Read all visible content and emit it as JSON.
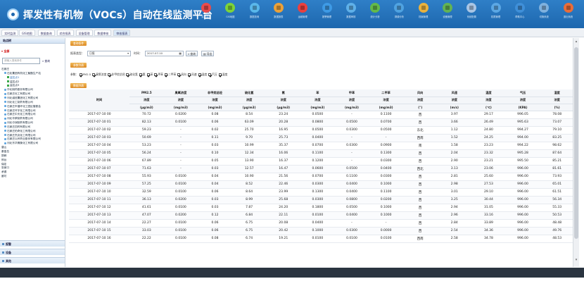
{
  "header": {
    "title": "挥发性有机物（VOCs）自动在线监测平台",
    "nav": [
      {
        "label": "实时监测",
        "color": "#e94b4b"
      },
      {
        "label": "GIS地图",
        "color": "#7dd33a"
      },
      {
        "label": "数据查询",
        "color": "#59b7ea"
      },
      {
        "label": "数据报表",
        "color": "#eaa13a"
      },
      {
        "label": "运维管理",
        "color": "#e84040"
      },
      {
        "label": "报警管理",
        "color": "#3e9ae5"
      },
      {
        "label": "数据审核",
        "color": "#5fb0e8"
      },
      {
        "label": "统计分析",
        "color": "#63b94a"
      },
      {
        "label": "溯源分析",
        "color": "#4fa2e0"
      },
      {
        "label": "档案管理",
        "color": "#e9b23e"
      },
      {
        "label": "设备管理",
        "color": "#62b354"
      },
      {
        "label": "系统配置",
        "color": "#a9c5e4"
      },
      {
        "label": "权限管理",
        "color": "#5ba7e4"
      },
      {
        "label": "帮助中心",
        "color": "#3f8fd8"
      },
      {
        "label": "切换系统",
        "color": "#7fb1de"
      },
      {
        "label": "退出系统",
        "color": "#e96d3a"
      }
    ]
  },
  "tabs": [
    "实时监测",
    "GIS地图",
    "数据查询",
    "综合报表",
    "设备管理",
    "数据审核",
    "审核报表"
  ],
  "sidebar": {
    "header": "站点树",
    "scope": "全部",
    "search_placeholder": "请输入搜索条件",
    "search_button": "查询",
    "tree": [
      {
        "label": "石家庄",
        "level": 0,
        "type": "folder"
      },
      {
        "label": "石化集团有机化工聚酯生产站",
        "level": 1,
        "type": "site"
      },
      {
        "label": "监控点1",
        "level": 2,
        "type": "point",
        "selected": true
      },
      {
        "label": "监控点2",
        "level": 2,
        "type": "point"
      },
      {
        "label": "监控点3",
        "level": 2,
        "type": "point"
      },
      {
        "label": "华北制药股份有限公司",
        "level": 1,
        "type": "site"
      },
      {
        "label": "石家庄化工有限公司",
        "level": 1,
        "type": "site"
      },
      {
        "label": "河北诚信集团化工有限公司",
        "level": 1,
        "type": "site"
      },
      {
        "label": "河北化工制药有限公司",
        "level": 1,
        "type": "site"
      },
      {
        "label": "石家庄市循环化工园区管委会",
        "level": 1,
        "type": "site"
      },
      {
        "label": "石家庄环宇化工有限公司",
        "level": 1,
        "type": "site"
      },
      {
        "label": "石家庄中天化工有限公司",
        "level": 1,
        "type": "site"
      },
      {
        "label": "河北华荣制药有限公司",
        "level": 1,
        "type": "site"
      },
      {
        "label": "河北中润制药有限公司",
        "level": 1,
        "type": "site"
      },
      {
        "label": "石家庄四药有限公司",
        "level": 1,
        "type": "site"
      },
      {
        "label": "石家庄柏奇化工有限公司",
        "level": 1,
        "type": "site"
      },
      {
        "label": "石家庄杰克化工有限公司",
        "level": 1,
        "type": "site"
      },
      {
        "label": "石家庄以岭药业股份有限公司",
        "level": 1,
        "type": "site"
      },
      {
        "label": "河北东华冀衡化工有限公司",
        "level": 1,
        "type": "site"
      },
      {
        "label": "唐山",
        "level": 0,
        "type": "folder"
      },
      {
        "label": "秦皇岛",
        "level": 0,
        "type": "folder"
      },
      {
        "label": "邯郸",
        "level": 0,
        "type": "folder"
      },
      {
        "label": "邢台",
        "level": 0,
        "type": "folder"
      },
      {
        "label": "保定",
        "level": 0,
        "type": "folder"
      },
      {
        "label": "张家口",
        "level": 0,
        "type": "folder"
      },
      {
        "label": "承德",
        "level": 0,
        "type": "folder"
      },
      {
        "label": "廊坊",
        "level": 0,
        "type": "folder"
      }
    ],
    "accordions": [
      "报警",
      "设备",
      "其他"
    ]
  },
  "query_panel": {
    "title": "查询条件",
    "type_label": "报表类型：",
    "type_value": "日报",
    "time_label": "时间：",
    "time_value": "2017-07-10",
    "query_button": "查询",
    "export_button": "导出"
  },
  "param_panel": {
    "title": "参数列表",
    "label": "参数：",
    "params": [
      "PM2.5",
      "臭氧浓度",
      "非甲烷总烃",
      "硫化氢",
      "氨",
      "苯",
      "甲苯",
      "二甲苯",
      "风向",
      "风速",
      "温度",
      "气压",
      "湿度"
    ]
  },
  "table_panel": {
    "title": "数据列表",
    "time_header": "时间",
    "columns": [
      {
        "name": "PM2.5",
        "sub": "浓度",
        "unit": "(μg/m3)"
      },
      {
        "name": "臭氧浓度",
        "sub": "浓度",
        "unit": "(mg/m3)"
      },
      {
        "name": "非甲烷总烃",
        "sub": "浓度",
        "unit": "(mg/m3)"
      },
      {
        "name": "硫化氢",
        "sub": "浓度",
        "unit": "(μg/m3)"
      },
      {
        "name": "氨",
        "sub": "浓度",
        "unit": "(μg/m3)"
      },
      {
        "name": "苯",
        "sub": "浓度",
        "unit": "(mg/m3)"
      },
      {
        "name": "甲苯",
        "sub": "浓度",
        "unit": "(mg/m3)"
      },
      {
        "name": "二甲苯",
        "sub": "浓度",
        "unit": "(mg/m3)"
      },
      {
        "name": "风向",
        "sub": "浓度",
        "unit": "(°)"
      },
      {
        "name": "风速",
        "sub": "浓度",
        "unit": "(m/s)"
      },
      {
        "name": "温度",
        "sub": "浓度",
        "unit": "(℃)"
      },
      {
        "name": "气压",
        "sub": "浓度",
        "unit": "(KPA)"
      },
      {
        "name": "湿度",
        "sub": "浓度",
        "unit": "(%)"
      }
    ],
    "rows": [
      [
        "2017-07-10 00",
        "70.72",
        "0.0200",
        "0.08",
        "8.54",
        "23.24",
        "0.0500",
        "-",
        "0.1100",
        "西",
        "3.97",
        "29.17",
        "996.05",
        "78.08"
      ],
      [
        "2017-07-10 01",
        "82.13",
        "0.0100",
        "0.06",
        "63.09",
        "20.28",
        "0.0800",
        "0.0500",
        "0.0700",
        "西",
        "3.66",
        "26.49",
        "995.63",
        "73.07"
      ],
      [
        "2017-07-10 02",
        "59.23",
        "-",
        "0.02",
        "25.70",
        "16.95",
        "0.0500",
        "0.0300",
        "0.0500",
        "东北",
        "1.12",
        "24.80",
        "994.27",
        "79.10"
      ],
      [
        "2017-07-10 03",
        "50.69",
        "-",
        "0.11",
        "9.70",
        "25.73",
        "0.0400",
        "-",
        "-",
        "西南",
        "1.52",
        "24.25",
        "994.00",
        "83.25"
      ],
      [
        "2017-07-10 04",
        "53.23",
        "-",
        "0.03",
        "10.99",
        "35.37",
        "0.0700",
        "0.0300",
        "0.0900",
        "南",
        "1.58",
        "23.23",
        "994.22",
        "98.62"
      ],
      [
        "2017-07-10 05",
        "56.24",
        "-",
        "0.10",
        "12.34",
        "16.06",
        "0.1100",
        "-",
        "0.1300",
        "西",
        "2.04",
        "23.32",
        "995.28",
        "87.64"
      ],
      [
        "2017-07-10 06",
        "67.89",
        "-",
        "0.05",
        "13.90",
        "16.37",
        "0.1200",
        "-",
        "0.0300",
        "西",
        "2.90",
        "23.21",
        "995.50",
        "85.21"
      ],
      [
        "2017-07-10 07",
        "71.63",
        "-",
        "0.03",
        "12.57",
        "16.47",
        "0.0600",
        "0.0500",
        "0.0400",
        "西北",
        "3.13",
        "23.06",
        "996.00",
        "81.61"
      ],
      [
        "2017-07-10 08",
        "55.93",
        "0.0100",
        "0.04",
        "10.90",
        "21.56",
        "0.0700",
        "0.1100",
        "0.0300",
        "西",
        "2.81",
        "25.60",
        "996.00",
        "73.93"
      ],
      [
        "2017-07-10 09",
        "57.25",
        "0.0100",
        "0.04",
        "8.52",
        "22.46",
        "0.0300",
        "0.0400",
        "0.1000",
        "西",
        "2.98",
        "27.53",
        "996.00",
        "65.01"
      ],
      [
        "2017-07-10 10",
        "32.59",
        "0.0100",
        "0.06",
        "8.64",
        "23.99",
        "0.1300",
        "0.0400",
        "0.1100",
        "西",
        "3.01",
        "29.10",
        "996.00",
        "61.51"
      ],
      [
        "2017-07-10 11",
        "36.13",
        "0.0200",
        "0.03",
        "8.99",
        "25.68",
        "0.0300",
        "0.0800",
        "0.0200",
        "西",
        "3.25",
        "30.44",
        "996.00",
        "56.34"
      ],
      [
        "2017-07-10 12",
        "41.61",
        "0.0100",
        "0.03",
        "7.87",
        "24.20",
        "0.1800",
        "0.0500",
        "0.1000",
        "西",
        "2.94",
        "31.05",
        "996.00",
        "55.33"
      ],
      [
        "2017-07-10 13",
        "47.07",
        "0.0200",
        "0.12",
        "6.84",
        "22.11",
        "0.0100",
        "0.0400",
        "0.1000",
        "西",
        "2.96",
        "33.16",
        "996.00",
        "50.53"
      ],
      [
        "2017-07-10 14",
        "22.27",
        "0.0100",
        "0.06",
        "6.75",
        "20.08",
        "0.0400",
        "-",
        "-",
        "西",
        "2.84",
        "33.89",
        "996.00",
        "48.48"
      ],
      [
        "2017-07-10 15",
        "33.03",
        "0.0100",
        "0.06",
        "6.75",
        "20.42",
        "0.1000",
        "0.0300",
        "0.0000",
        "西",
        "2.54",
        "34.36",
        "996.00",
        "49.76"
      ],
      [
        "2017-07-10 16",
        "22.22",
        "0.0100",
        "0.08",
        "6.74",
        "19.21",
        "0.0100",
        "0.0100",
        "0.0100",
        "西南",
        "2.58",
        "34.78",
        "996.00",
        "48.53"
      ]
    ]
  }
}
